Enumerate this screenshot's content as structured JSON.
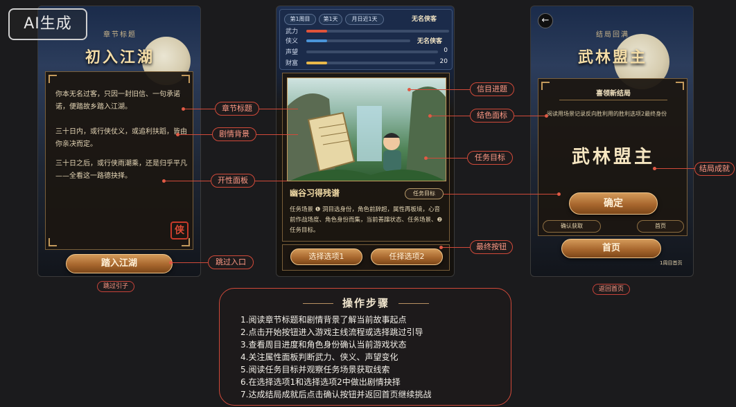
{
  "watermark": "AI生成",
  "left_screen": {
    "section_label": "章节标题",
    "title": "初入江湖",
    "paragraphs": [
      "你本无名过客，只因一封旧信、一句承诺诺，便踏故乡踏入江湖。",
      "三十日内，或行侠仗义，或追利扶蹈，皆由你亲决而定。",
      "三十日之后，或行侠雨潮乘，还是归乎平凡——全看这一路德抉择。"
    ],
    "seal_char": "侠",
    "start_button": "踏入江湖",
    "skip_label": "跳过引子"
  },
  "middle_screen": {
    "chips": [
      "第1周目",
      "第1天",
      "月日近1天"
    ],
    "identity_top": "无名侠客",
    "stats": [
      {
        "label": "武力",
        "value": "",
        "fill": 0.14,
        "color": "#e0533a"
      },
      {
        "label": "侠义",
        "value": "无名侠客",
        "fill": 0.14,
        "color": "#4a94d8"
      },
      {
        "label": "声望",
        "value": "0",
        "fill": 0.0,
        "color": "#4a94d8"
      },
      {
        "label": "财富",
        "value": "20",
        "fill": 0.14,
        "color": "#e8b84a"
      }
    ],
    "scene_title": "幽谷习得残谱",
    "task_badge": "任务目标",
    "scene_text": "任务场景 ❶ 洞目选身份，角色前辞超，属性再板境，心音前作战场度、角色身份而集，当前善蹿状态、任务场景、❷ 任务目标。",
    "choice1": "选择选项1",
    "choice2": "任择选项2"
  },
  "right_screen": {
    "section_label": "结局回满",
    "title": "武林盟主",
    "panel_header": "喜领新结局",
    "panel_text": "阅读用场景记录反向胜利用的胜利选项2最终身份",
    "ending_name": "武林盟主",
    "confirm_button": "确定",
    "confirm_login": "确认获取",
    "home_small": "首页",
    "home_button": "首页",
    "round_label": "1周目首页",
    "return_label": "返回首页"
  },
  "callouts": {
    "chapter_title": "章节标题",
    "story_bg": "剧情背景",
    "attr_panel": "开性面板",
    "skip_entry": "跳过入口",
    "info_progress": "信目进题",
    "role_panel": "结色面标",
    "task_target": "任务目标",
    "final_button": "最终按钮",
    "ending_achievement": "结局成就"
  },
  "steps": {
    "title": "操作步骤",
    "items": [
      "1.阅读章节标题和剧情背景了解当前故事起点",
      "2.点击开始按钮进入游戏主线流程或选择跳过引导",
      "3.查看周目进度和角色身份确认当前游戏状态",
      "4.关注属性面板判断武力、侠义、声望变化",
      "5.阅读任务目标并观察任务场景获取线索",
      "6.在选择选项1和选择选项2中做出剧情抉择",
      "7.达成结局成就后点击确认按钮并返回首页继续挑战"
    ]
  }
}
